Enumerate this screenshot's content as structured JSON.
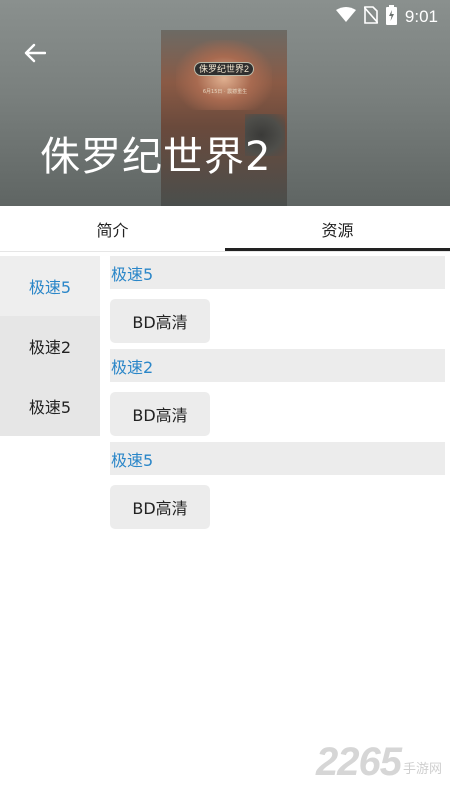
{
  "status_bar": {
    "time": "9:01",
    "icons": [
      "wifi-icon",
      "no-sim-icon",
      "battery-charging-icon"
    ]
  },
  "header": {
    "title": "侏罗纪世界2",
    "back_icon": "arrow-left-icon",
    "poster": {
      "logo_text": "侏罗纪世界2",
      "date_text": "6月15日 · 震撼重生"
    }
  },
  "tabs": [
    {
      "label": "简介",
      "active": false
    },
    {
      "label": "资源",
      "active": true
    }
  ],
  "sources": [
    {
      "label": "极速5",
      "active": true
    },
    {
      "label": "极速2",
      "active": false
    },
    {
      "label": "极速5",
      "active": false
    }
  ],
  "groups": [
    {
      "title": "极速5",
      "quality": "BD高清"
    },
    {
      "title": "极速2",
      "quality": "BD高清"
    },
    {
      "title": "极速5",
      "quality": "BD高清"
    }
  ],
  "watermark": {
    "number": "2265",
    "text": "手游网"
  },
  "colors": {
    "accent": "#2a86c8",
    "header_bg": "#7a807e",
    "item_bg": "#ececec"
  }
}
